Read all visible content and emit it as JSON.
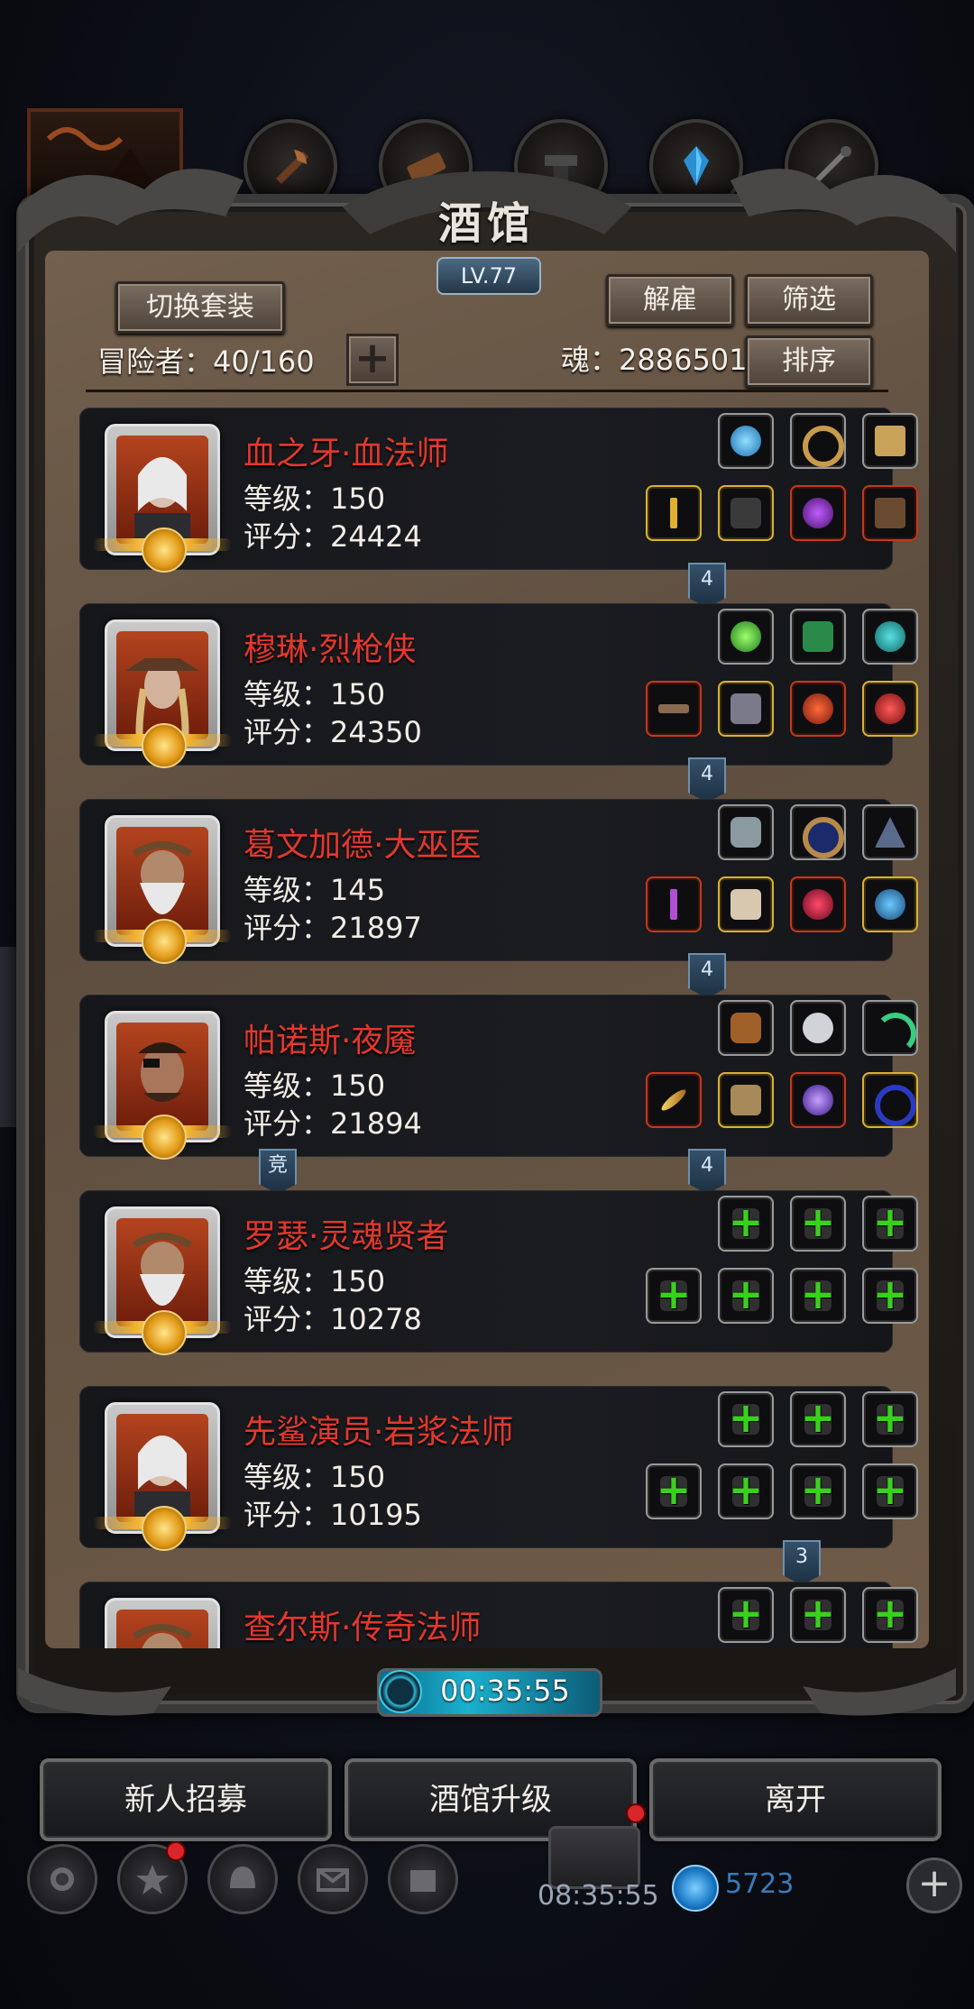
{
  "header": {
    "title": "酒馆",
    "level": "LV.77",
    "switch_outfit": "切换套装",
    "dismiss": "解雇",
    "filter": "筛选",
    "sort": "排序",
    "adventurers_label": "冒险者：40/160",
    "soul_label": "魂：2886501",
    "add_symbol": "+"
  },
  "heroes": [
    {
      "name": "血之牙·血法师",
      "level": "等级：150",
      "score": "评分：24424",
      "tag": "4",
      "equipped": true
    },
    {
      "name": "穆琳·烈枪侠",
      "level": "等级：150",
      "score": "评分：24350",
      "tag": "4",
      "equipped": true
    },
    {
      "name": "葛文加德·大巫医",
      "level": "等级：145",
      "score": "评分：21897",
      "tag": "4",
      "equipped": true
    },
    {
      "name": "帕诺斯·夜魇",
      "level": "等级：150",
      "score": "评分：21894",
      "tag": "4",
      "side_tag": "竞",
      "equipped": true
    },
    {
      "name": "罗瑟·灵魂贤者",
      "level": "等级：150",
      "score": "评分：10278",
      "equipped": false
    },
    {
      "name": "先鲨演员·岩浆法师",
      "level": "等级：150",
      "score": "评分：10195",
      "tag": "3",
      "equipped": false
    },
    {
      "name": "查尔斯·传奇法师",
      "level": "",
      "score": "",
      "equipped": false
    }
  ],
  "timer": {
    "value": "00:35:55"
  },
  "bottom": {
    "recruit": "新人招募",
    "upgrade": "酒馆升级",
    "leave": "离开"
  },
  "dock": {
    "timer": "08:35:55",
    "gems": "5723",
    "plus": "+"
  },
  "icons": {
    "top": [
      "flag-icon",
      "axe-icon",
      "wood-icon",
      "anvil-icon",
      "crystal-icon",
      "weapon-icon"
    ],
    "dock": [
      "gear-icon",
      "star-icon",
      "helmet-icon",
      "mail-icon",
      "box-icon"
    ]
  },
  "colors": {
    "hero_name": "#e4382e",
    "plus_green": "#39d11d",
    "tag_blue": "#34506a"
  }
}
